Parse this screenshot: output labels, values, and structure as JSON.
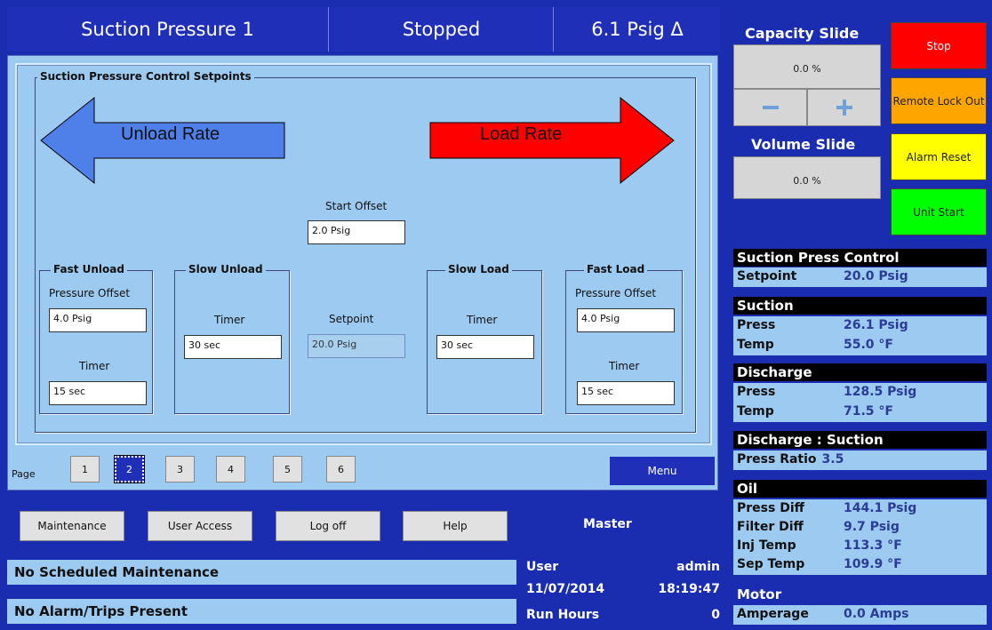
{
  "header": {
    "title": "Suction Pressure 1",
    "status": "Stopped",
    "pressure_delta": "6.1 Psig Δ"
  },
  "group_title": "Suction Pressure Control Setpoints",
  "arrows": {
    "unload": {
      "label": "Unload Rate",
      "color": "#4f7fe8"
    },
    "load": {
      "label": "Load Rate",
      "color": "#ff0000"
    }
  },
  "start_offset": {
    "label": "Start Offset",
    "value": "2.0 Psig"
  },
  "setpoint": {
    "label": "Setpoint",
    "value": "20.0 Psig"
  },
  "fast_unload": {
    "title": "Fast Unload",
    "pressure_label": "Pressure Offset",
    "pressure_value": "4.0 Psig",
    "timer_label": "Timer",
    "timer_value": "15 sec"
  },
  "slow_unload": {
    "title": "Slow Unload",
    "timer_label": "Timer",
    "timer_value": "30 sec"
  },
  "slow_load": {
    "title": "Slow Load",
    "timer_label": "Timer",
    "timer_value": "30 sec"
  },
  "fast_load": {
    "title": "Fast Load",
    "pressure_label": "Pressure Offset",
    "pressure_value": "4.0 Psig",
    "timer_label": "Timer",
    "timer_value": "15 sec"
  },
  "pager": {
    "label": "Page",
    "pages": [
      "1",
      "2",
      "3",
      "4",
      "5",
      "6"
    ],
    "current": "2",
    "menu_label": "Menu"
  },
  "bottom_buttons": {
    "maintenance": "Maintenance",
    "user_access": "User Access",
    "log_off": "Log off",
    "help": "Help"
  },
  "status_bars": {
    "maintenance": "No Scheduled Maintenance",
    "alarms": "No Alarm/Trips Present"
  },
  "session": {
    "role": "Master",
    "user_label": "User",
    "user_value": "admin",
    "date": "11/07/2014",
    "time": "18:19:47",
    "run_hours_label": "Run Hours",
    "run_hours_value": "0"
  },
  "capacity_slide": {
    "title": "Capacity Slide",
    "value": "0.0 %",
    "minus_icon": "minus-icon",
    "plus_icon": "plus-icon"
  },
  "volume_slide": {
    "title": "Volume Slide",
    "value": "0.0 %"
  },
  "side_buttons": {
    "stop": {
      "label": "Stop",
      "color": "#ff0000"
    },
    "remote_lockout": {
      "label": "Remote Lock Out",
      "color": "#ffa500"
    },
    "alarm_reset": {
      "label": "Alarm Reset",
      "color": "#ffff00"
    },
    "unit_start": {
      "label": "Unit Start",
      "color": "#00ff00"
    }
  },
  "readouts": {
    "suction_press_control": {
      "title": "Suction Press Control",
      "setpoint_label": "Setpoint",
      "setpoint_value": "20.0 Psig"
    },
    "suction": {
      "title": "Suction",
      "press_label": "Press",
      "press_value": "26.1 Psig",
      "temp_label": "Temp",
      "temp_value": "55.0 °F"
    },
    "discharge": {
      "title": "Discharge",
      "press_label": "Press",
      "press_value": "128.5 Psig",
      "temp_label": "Temp",
      "temp_value": "71.5 °F"
    },
    "ratio": {
      "title": "Discharge : Suction",
      "label": "Press Ratio",
      "value": "3.5"
    },
    "oil": {
      "title": "Oil",
      "press_diff_label": "Press Diff",
      "press_diff_value": "144.1 Psig",
      "filter_diff_label": "Filter Diff",
      "filter_diff_value": "9.7 Psig",
      "inj_temp_label": "Inj Temp",
      "inj_temp_value": "113.3 °F",
      "sep_temp_label": "Sep Temp",
      "sep_temp_value": "109.9 °F"
    },
    "motor": {
      "title": "Motor",
      "amperage_label": "Amperage",
      "amperage_value": "0.0 Amps"
    }
  }
}
